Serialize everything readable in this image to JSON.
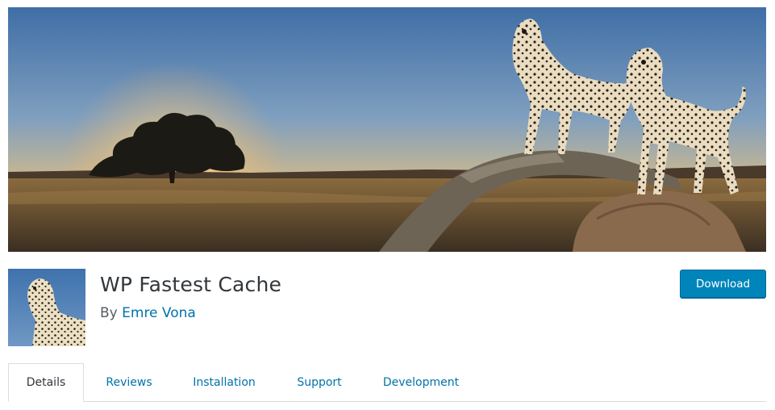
{
  "plugin": {
    "title": "WP Fastest Cache",
    "by_prefix": "By",
    "author": "Emre Vona",
    "download_label": "Download"
  },
  "tabs": [
    {
      "label": "Details",
      "active": true
    },
    {
      "label": "Reviews",
      "active": false
    },
    {
      "label": "Installation",
      "active": false
    },
    {
      "label": "Support",
      "active": false
    },
    {
      "label": "Development",
      "active": false
    }
  ],
  "colors": {
    "accent": "#0073aa",
    "button": "#0085ba",
    "title": "#32373c"
  }
}
